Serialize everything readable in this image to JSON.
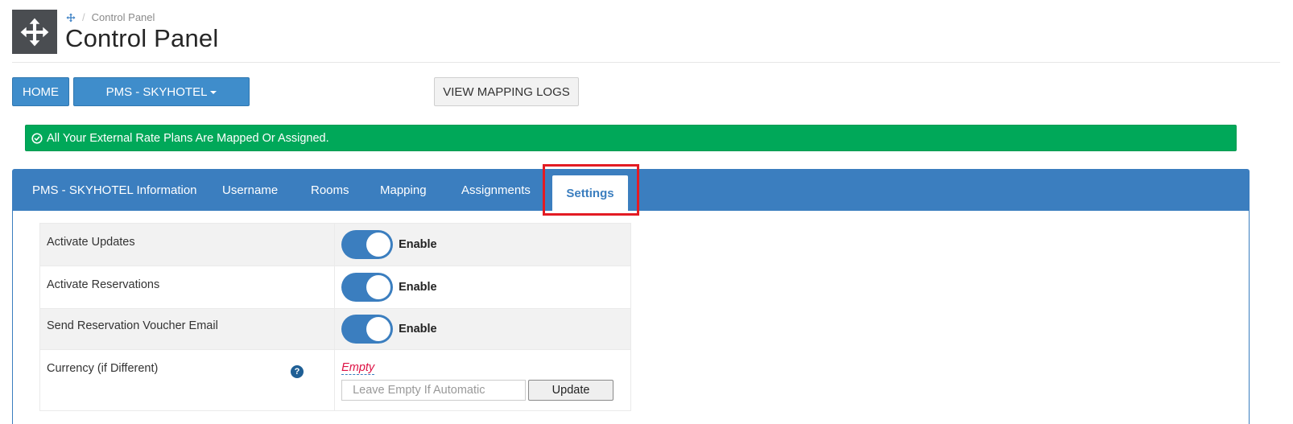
{
  "header": {
    "breadcrumb": {
      "sep": "/",
      "current": "Control Panel",
      "icon": "move-arrows-icon"
    },
    "title": "Control Panel",
    "logo_icon": "move-arrows-icon"
  },
  "toolbar": {
    "home_label": "HOME",
    "pms_label": "PMS - SKYHOTEL",
    "logs_label": "VIEW MAPPING LOGS"
  },
  "alert": {
    "icon": "check-circle-icon",
    "message": "All Your External Rate Plans Are Mapped Or Assigned."
  },
  "tabs": [
    {
      "label": "PMS - SKYHOTEL Information",
      "active": false
    },
    {
      "label": "Username",
      "active": false
    },
    {
      "label": "Rooms",
      "active": false
    },
    {
      "label": "Mapping",
      "active": false
    },
    {
      "label": "Assignments",
      "active": false
    },
    {
      "label": "Settings",
      "active": true
    }
  ],
  "settings": {
    "rows": [
      {
        "label": "Activate Updates",
        "state": "Enable",
        "on": true
      },
      {
        "label": "Activate Reservations",
        "state": "Enable",
        "on": true
      },
      {
        "label": "Send Reservation Voucher Email",
        "state": "Enable",
        "on": true
      }
    ],
    "currency": {
      "label": "Currency (if Different)",
      "help_icon": "question-circle-icon",
      "value": "Empty",
      "placeholder": "Leave Empty If Automatic",
      "update_label": "Update"
    }
  },
  "colors": {
    "brand_blue": "#3b7ebf",
    "button_blue": "#3f8dcb",
    "success_green": "#00a859",
    "highlight_red": "#e31b23",
    "empty_value": "#dd1144"
  }
}
